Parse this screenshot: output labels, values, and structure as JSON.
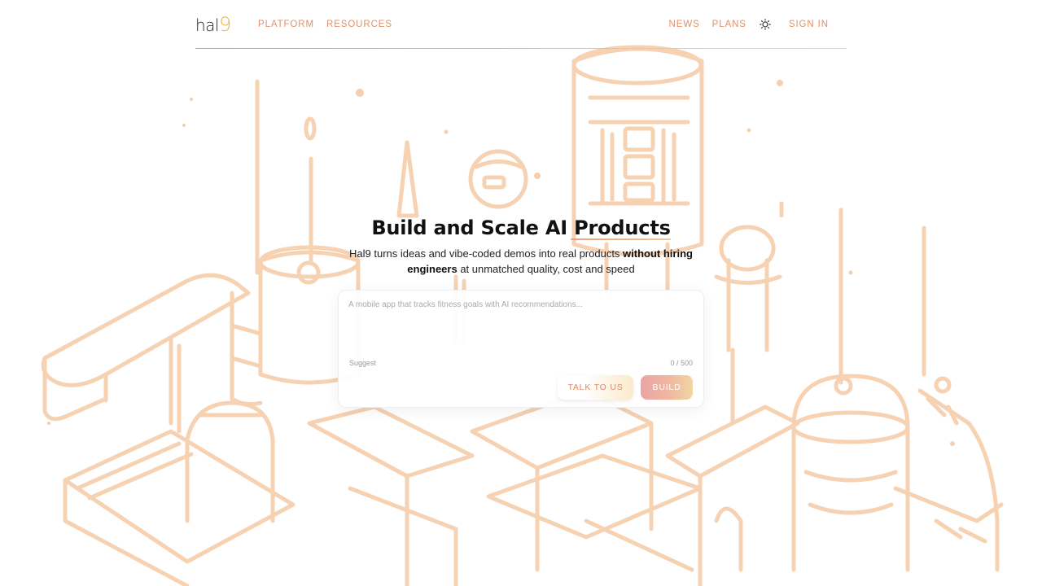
{
  "brand": {
    "logo_text": "hal",
    "logo_accent": "9"
  },
  "nav": {
    "left": [
      {
        "label": "PLATFORM"
      },
      {
        "label": "RESOURCES"
      }
    ],
    "right": [
      {
        "label": "NEWS"
      },
      {
        "label": "PLANS"
      }
    ],
    "sign_in": "SIGN IN",
    "theme_icon": "sun-icon"
  },
  "hero": {
    "title": "Build and Scale AI Products",
    "subtitle_part1": "Hal9 turns ideas and vibe-coded demos into real products ",
    "subtitle_bold": "without hiring engineers",
    "subtitle_part2": " at unmatched quality, cost and speed"
  },
  "prompt_card": {
    "placeholder": "A mobile app that tracks fitness goals with AI recommendations...",
    "value": "",
    "suggest_label": "Suggest",
    "char_count": "0 / 500",
    "talk_button": "TALK TO US",
    "build_button": "BUILD"
  },
  "colors": {
    "accent_orange": "#e09268",
    "line_art": "#f6cfae",
    "logo_accent": "#e6b94d",
    "build_gradient_start": "#eba4a5",
    "build_gradient_end": "#f2d6a3"
  }
}
